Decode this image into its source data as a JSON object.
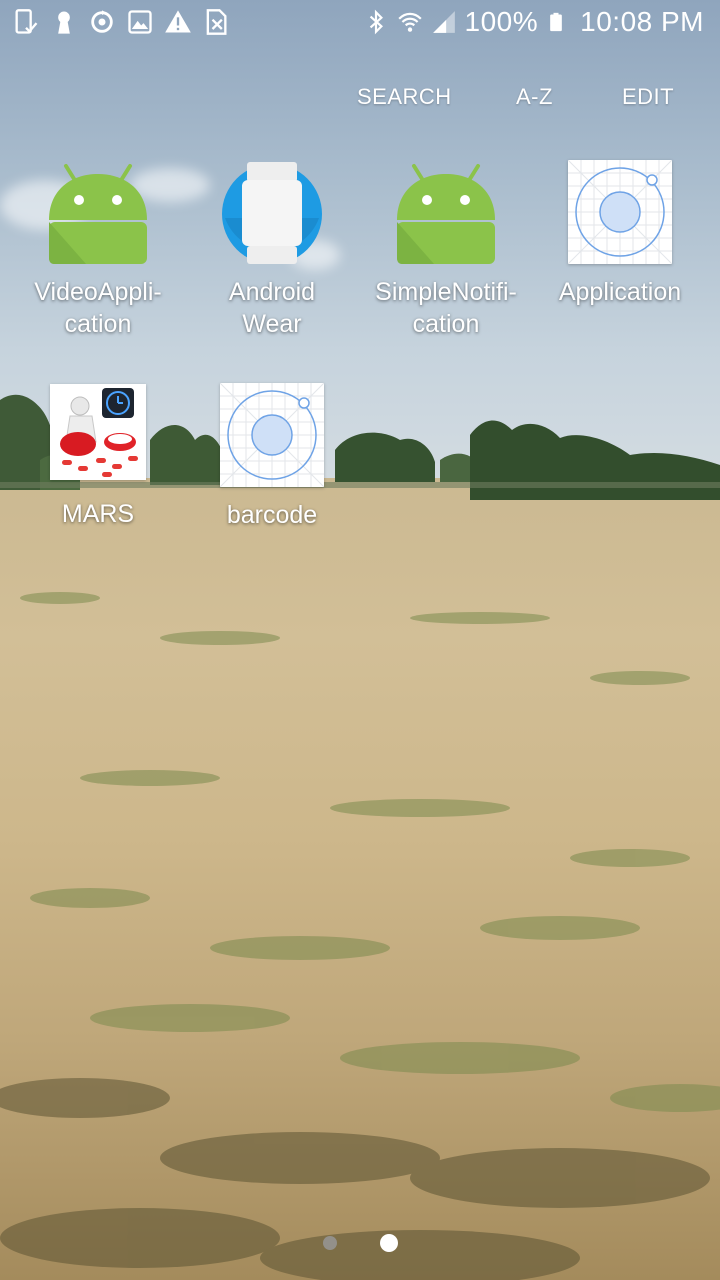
{
  "status_bar": {
    "left_icons": [
      "check-device-icon",
      "keyhole-icon",
      "sync-icon",
      "image-icon",
      "warning-icon",
      "no-sim-icon"
    ],
    "right_icons": [
      "bluetooth-icon",
      "wifi-icon",
      "signal-icon",
      "battery-icon"
    ],
    "battery": "100%",
    "time": "10:08 PM"
  },
  "actions": {
    "search": "SEARCH",
    "az": "A-Z",
    "edit": "EDIT"
  },
  "apps": [
    {
      "label": "VideoAppli-\ncation",
      "icon": "android-icon"
    },
    {
      "label": "Android\nWear",
      "icon": "android-wear-icon"
    },
    {
      "label": "SimpleNotifi-\ncation",
      "icon": "android-icon"
    },
    {
      "label": "Application",
      "icon": "default-app-icon"
    },
    {
      "label": "MARS",
      "icon": "mars-pills-icon"
    },
    {
      "label": "barcode",
      "icon": "default-app-icon"
    }
  ],
  "page_indicator": {
    "pages": 2,
    "current": 2
  }
}
